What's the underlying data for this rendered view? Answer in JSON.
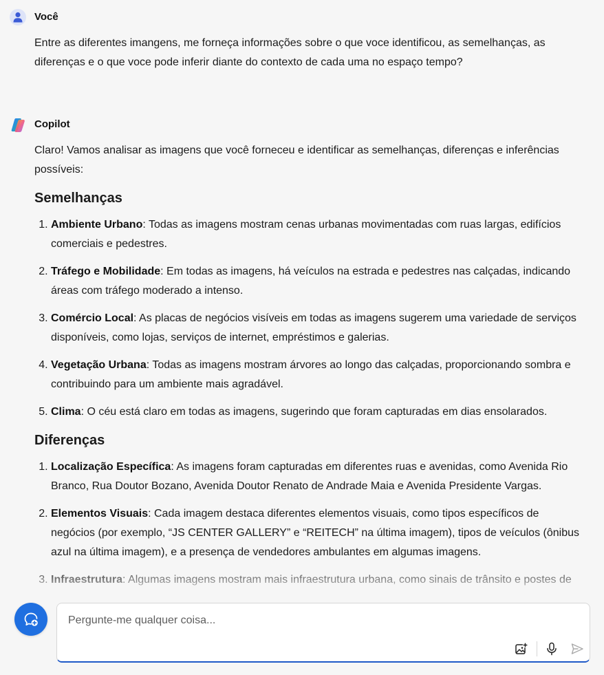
{
  "conversation": {
    "user": {
      "name": "Você",
      "message": "Entre as diferentes imangens, me forneça informações sobre o que voce identificou, as semelhanças, as diferenças e o que voce pode inferir diante do contexto de cada uma no espaço tempo?"
    },
    "assistant": {
      "name": "Copilot",
      "intro": "Claro! Vamos analisar as imagens que você forneceu e identificar as semelhanças, diferenças e inferências possíveis:",
      "sections": [
        {
          "heading": "Semelhanças",
          "items": [
            {
              "title": "Ambiente Urbano",
              "text": ": Todas as imagens mostram cenas urbanas movimentadas com ruas largas, edifícios comerciais e pedestres."
            },
            {
              "title": "Tráfego e Mobilidade",
              "text": ": Em todas as imagens, há veículos na estrada e pedestres nas calçadas, indicando áreas com tráfego moderado a intenso."
            },
            {
              "title": "Comércio Local",
              "text": ": As placas de negócios visíveis em todas as imagens sugerem uma variedade de serviços disponíveis, como lojas, serviços de internet, empréstimos e galerias."
            },
            {
              "title": "Vegetação Urbana",
              "text": ": Todas as imagens mostram árvores ao longo das calçadas, proporcionando sombra e contribuindo para um ambiente mais agradável."
            },
            {
              "title": "Clima",
              "text": ": O céu está claro em todas as imagens, sugerindo que foram capturadas em dias ensolarados."
            }
          ]
        },
        {
          "heading": "Diferenças",
          "items": [
            {
              "title": "Localização Específica",
              "text": ": As imagens foram capturadas em diferentes ruas e avenidas, como Avenida Rio Branco, Rua Doutor Bozano, Avenida Doutor Renato de Andrade Maia e Avenida Presidente Vargas."
            },
            {
              "title": "Elementos Visuais",
              "text": ": Cada imagem destaca diferentes elementos visuais, como tipos específicos de negócios (por exemplo, “JS CENTER GALLERY” e “REITECH” na última imagem), tipos de veículos (ônibus azul na última imagem), e a presença de vendedores ambulantes em algumas imagens."
            },
            {
              "title": "Infraestrutura",
              "text": ": Algumas imagens mostram mais infraestrutura urbana, como sinais de trânsito e postes de"
            }
          ]
        }
      ]
    }
  },
  "composer": {
    "placeholder": "Pergunte-me qualquer coisa...",
    "value": ""
  },
  "icons": {
    "user_avatar": "person-icon",
    "copilot_logo": "copilot-logo-icon",
    "new_topic": "new-chat-icon",
    "image_upload": "add-image-icon",
    "microphone": "microphone-icon",
    "send": "send-icon"
  },
  "colors": {
    "background": "#f6f6f6",
    "accent": "#1f6fe0",
    "composer_focus_border": "#1d58c7"
  }
}
